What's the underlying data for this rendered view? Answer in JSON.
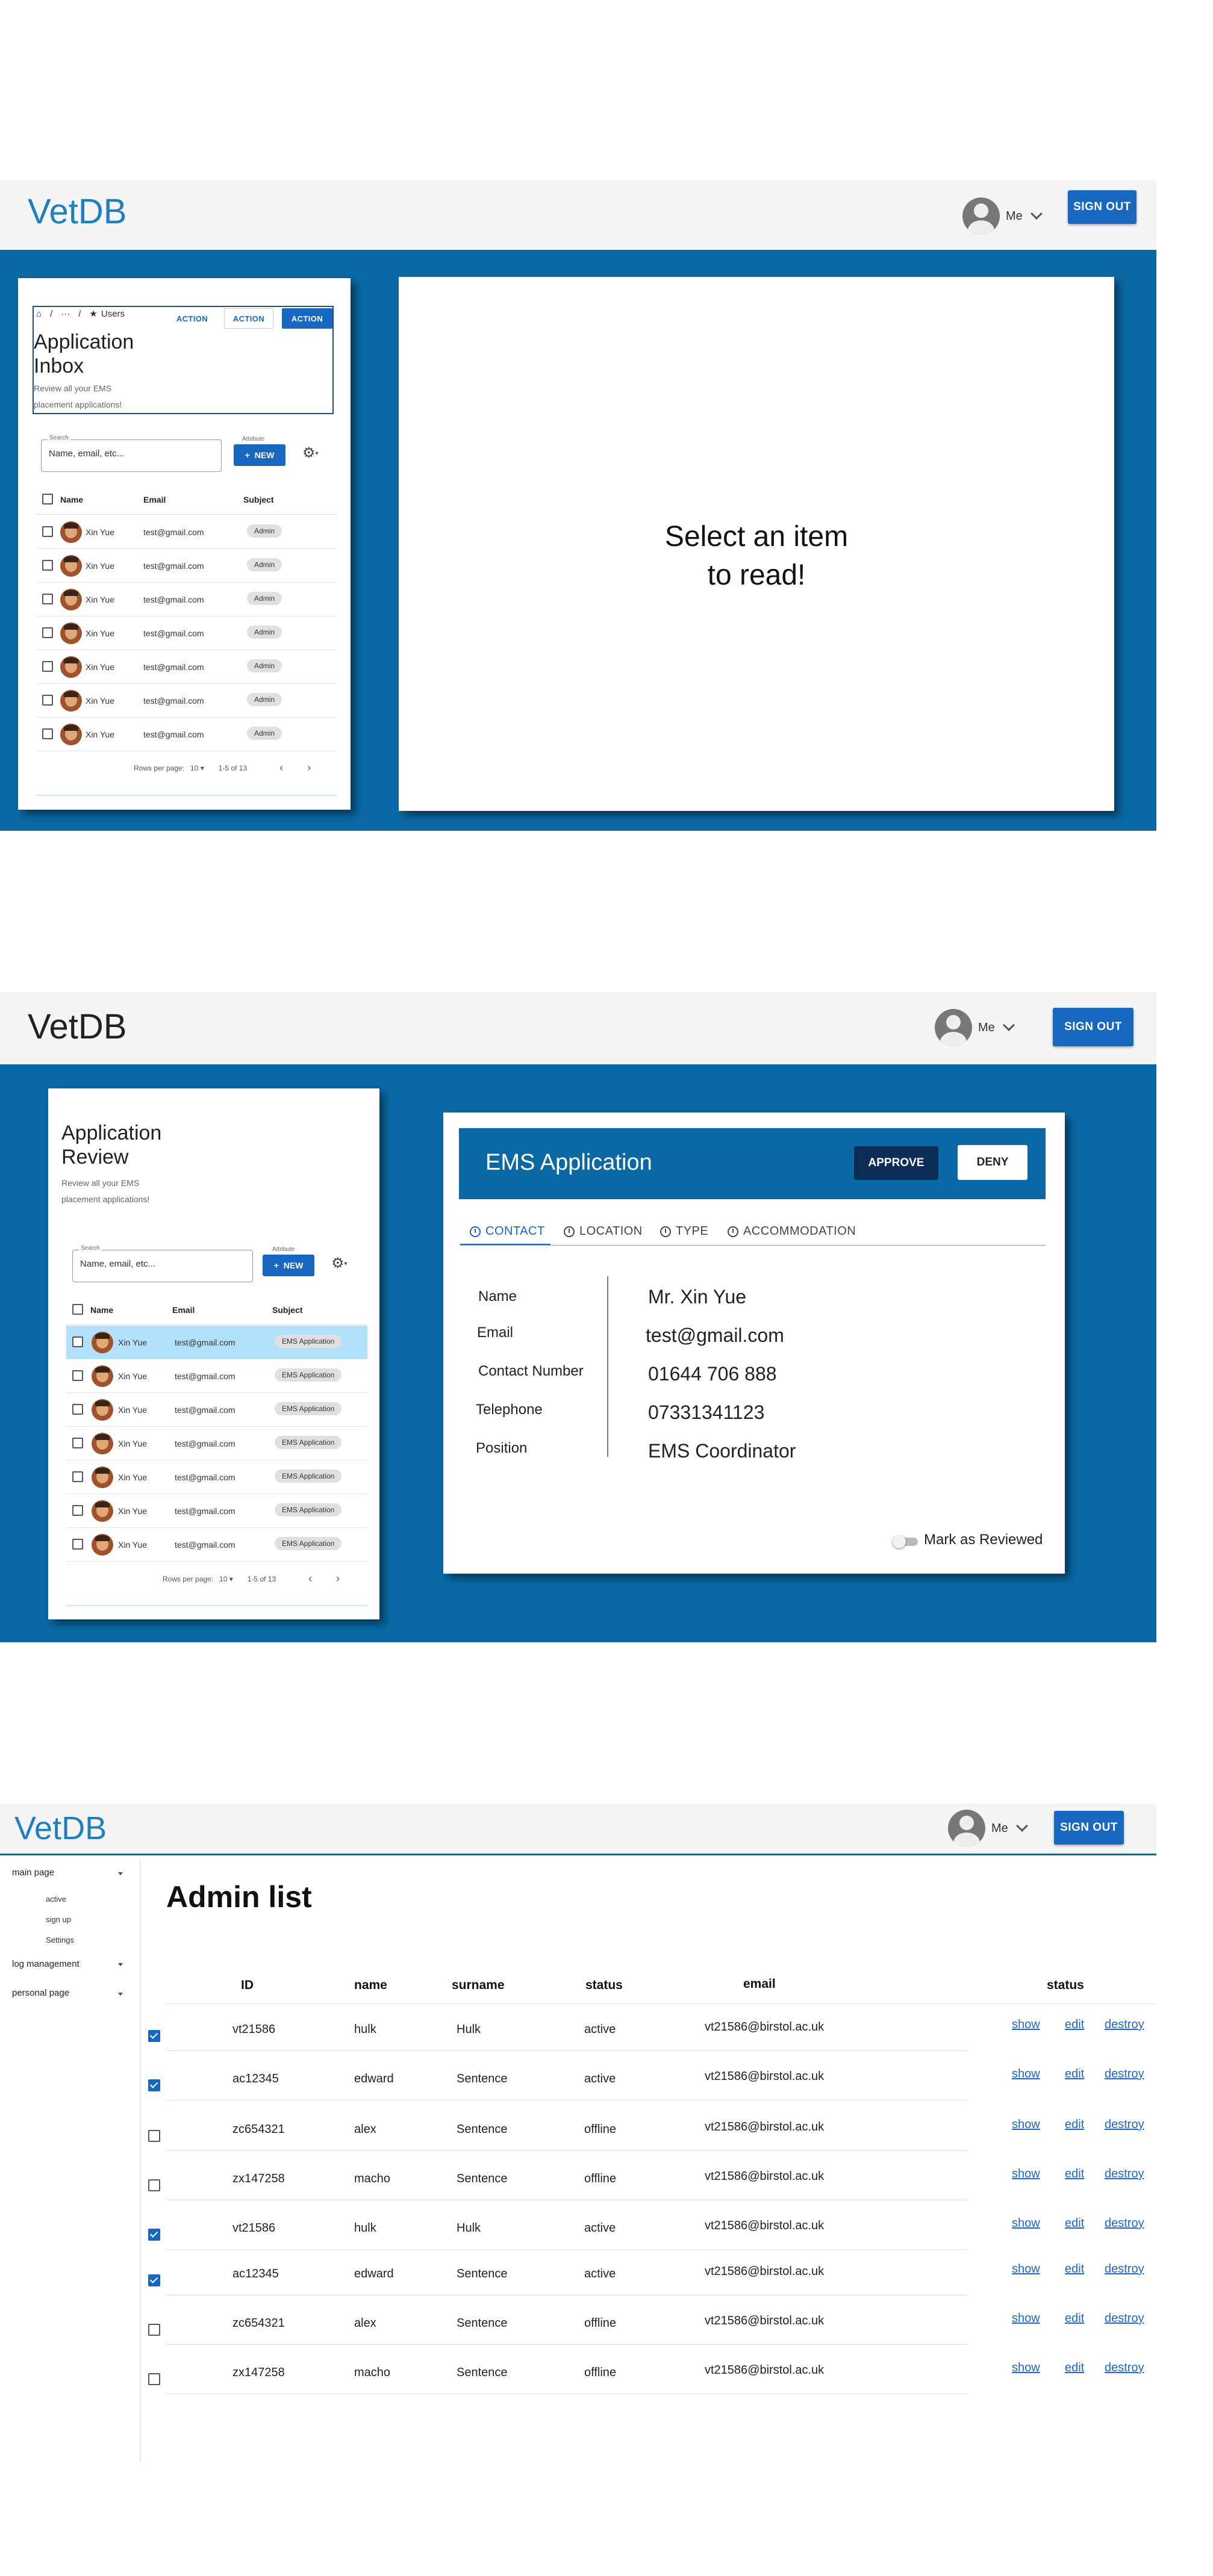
{
  "screen1": {
    "logo": "VetDB",
    "user": "Me",
    "sign_out": "SIGN OUT",
    "breadcrumb": [
      "/",
      "···",
      "/",
      "Users"
    ],
    "actions": [
      "ACTION",
      "ACTION",
      "ACTION"
    ],
    "title": "Application Inbox",
    "title_lines": [
      "Application",
      "Inbox"
    ],
    "subtitle_lines": [
      "Review all your EMS",
      "placement applications!"
    ],
    "search_label": "Search",
    "search_placeholder": "Name, email, etc...",
    "attribute_label": "Attribute",
    "new_button": "NEW",
    "columns": [
      "Name",
      "Email",
      "Subject"
    ],
    "rows": [
      {
        "name": "Xin Yue",
        "email": "test@gmail.com",
        "subject": "Admin"
      },
      {
        "name": "Xin Yue",
        "email": "test@gmail.com",
        "subject": "Admin"
      },
      {
        "name": "Xin Yue",
        "email": "test@gmail.com",
        "subject": "Admin"
      },
      {
        "name": "Xin Yue",
        "email": "test@gmail.com",
        "subject": "Admin"
      },
      {
        "name": "Xin Yue",
        "email": "test@gmail.com",
        "subject": "Admin"
      },
      {
        "name": "Xin Yue",
        "email": "test@gmail.com",
        "subject": "Admin"
      },
      {
        "name": "Xin Yue",
        "email": "test@gmail.com",
        "subject": "Admin"
      }
    ],
    "rows_per_page_label": "Rows per page:",
    "rows_per_page": "10",
    "range": "1-5 of 13",
    "read_message_lines": [
      "Select an item",
      "to read!"
    ]
  },
  "screen2": {
    "logo": "VetDB",
    "user": "Me",
    "sign_out": "SIGN OUT",
    "title_lines": [
      "Application",
      "Review"
    ],
    "subtitle_lines": [
      "Review all your EMS",
      "placement applications!"
    ],
    "search_label": "Search",
    "search_placeholder": "Name, email, etc...",
    "attribute_label": "Attribute",
    "new_button": "NEW",
    "columns": [
      "Name",
      "Email",
      "Subject"
    ],
    "rows": [
      {
        "name": "Xin Yue",
        "email": "test@gmail.com",
        "subject": "EMS Application",
        "selected": true
      },
      {
        "name": "Xin Yue",
        "email": "test@gmail.com",
        "subject": "EMS Application"
      },
      {
        "name": "Xin Yue",
        "email": "test@gmail.com",
        "subject": "EMS Application"
      },
      {
        "name": "Xin Yue",
        "email": "test@gmail.com",
        "subject": "EMS Application"
      },
      {
        "name": "Xin Yue",
        "email": "test@gmail.com",
        "subject": "EMS Application"
      },
      {
        "name": "Xin Yue",
        "email": "test@gmail.com",
        "subject": "EMS Application"
      },
      {
        "name": "Xin Yue",
        "email": "test@gmail.com",
        "subject": "EMS Application"
      }
    ],
    "rows_per_page_label": "Rows per page:",
    "rows_per_page": "10",
    "range": "1-5 of 13",
    "detail": {
      "title": "EMS Application",
      "approve": "APPROVE",
      "deny": "DENY",
      "tabs": [
        "CONTACT",
        "LOCATION",
        "TYPE",
        "ACCOMMODATION"
      ],
      "fields": [
        {
          "label": "Name",
          "value": "Mr. Xin Yue"
        },
        {
          "label": "Email",
          "value": "test@gmail.com"
        },
        {
          "label": "Contact Number",
          "value": "01644 706 888"
        },
        {
          "label": "Telephone",
          "value": "07331341123"
        },
        {
          "label": "Position",
          "value": "EMS Coordinator"
        }
      ],
      "mark_reviewed": "Mark as Reviewed"
    }
  },
  "screen3": {
    "logo": "VetDB",
    "user": "Me",
    "sign_out": "SIGN OUT",
    "sidebar": {
      "main_page": "main page",
      "sub_items": [
        "active",
        "sign up",
        "Settings"
      ],
      "log_management": "log management",
      "personal_page": "personal page"
    },
    "title": "Admin list",
    "columns": [
      "ID",
      "name",
      "surname",
      "status",
      "email",
      "status"
    ],
    "rows": [
      {
        "checked": true,
        "id": "vt21586",
        "name": "hulk",
        "surname": "Hulk",
        "status": "active",
        "email": "vt21586@birstol.ac.uk"
      },
      {
        "checked": true,
        "id": "ac12345",
        "name": "edward",
        "surname": "Sentence",
        "status": "active",
        "email": "vt21586@birstol.ac.uk"
      },
      {
        "checked": false,
        "id": "zc654321",
        "name": "alex",
        "surname": "Sentence",
        "status": "offline",
        "email": "vt21586@birstol.ac.uk"
      },
      {
        "checked": false,
        "id": "zx147258",
        "name": "macho",
        "surname": "Sentence",
        "status": "offline",
        "email": "vt21586@birstol.ac.uk"
      },
      {
        "checked": true,
        "id": "vt21586",
        "name": "hulk",
        "surname": "Hulk",
        "status": "active",
        "email": "vt21586@birstol.ac.uk"
      },
      {
        "checked": true,
        "id": "ac12345",
        "name": "edward",
        "surname": "Sentence",
        "status": "active",
        "email": "vt21586@birstol.ac.uk"
      },
      {
        "checked": false,
        "id": "zc654321",
        "name": "alex",
        "surname": "Sentence",
        "status": "offline",
        "email": "vt21586@birstol.ac.uk"
      },
      {
        "checked": false,
        "id": "zx147258",
        "name": "macho",
        "surname": "Sentence",
        "status": "offline",
        "email": "vt21586@birstol.ac.uk"
      }
    ],
    "actions": [
      "show",
      "edit",
      "destroy"
    ]
  },
  "colors": {
    "brand_blue": "#0a69a5",
    "button_blue": "#1867c0",
    "approve_navy": "#0c2d58",
    "selected_row": "#b3e0fb"
  }
}
